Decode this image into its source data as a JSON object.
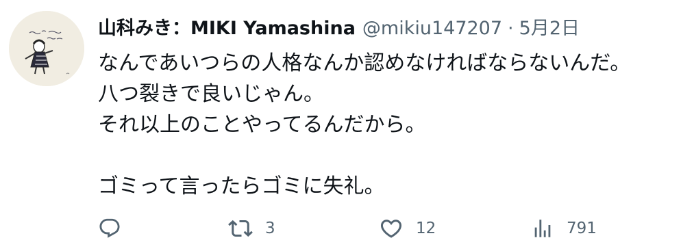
{
  "tweet": {
    "display_name": "山科みき：MIKI Yamashina",
    "handle": "@mikiu147207",
    "separator": "·",
    "date": "5月2日",
    "lines": [
      "なんであいつらの人格なんか認めなければならないんだ。",
      "八つ裂きで良いじゃん。",
      "それ以上のことやってるんだから。",
      "",
      "ゴミって言ったらゴミに失礼。"
    ],
    "actions": {
      "reply": {
        "icon": "reply-icon",
        "count": ""
      },
      "retweet": {
        "icon": "retweet-icon",
        "count": "3"
      },
      "like": {
        "icon": "heart-icon",
        "count": "12"
      },
      "views": {
        "icon": "views-icon",
        "count": "791"
      }
    },
    "colors": {
      "text": "#0f1419",
      "secondary": "#536471",
      "background": "#ffffff"
    }
  }
}
